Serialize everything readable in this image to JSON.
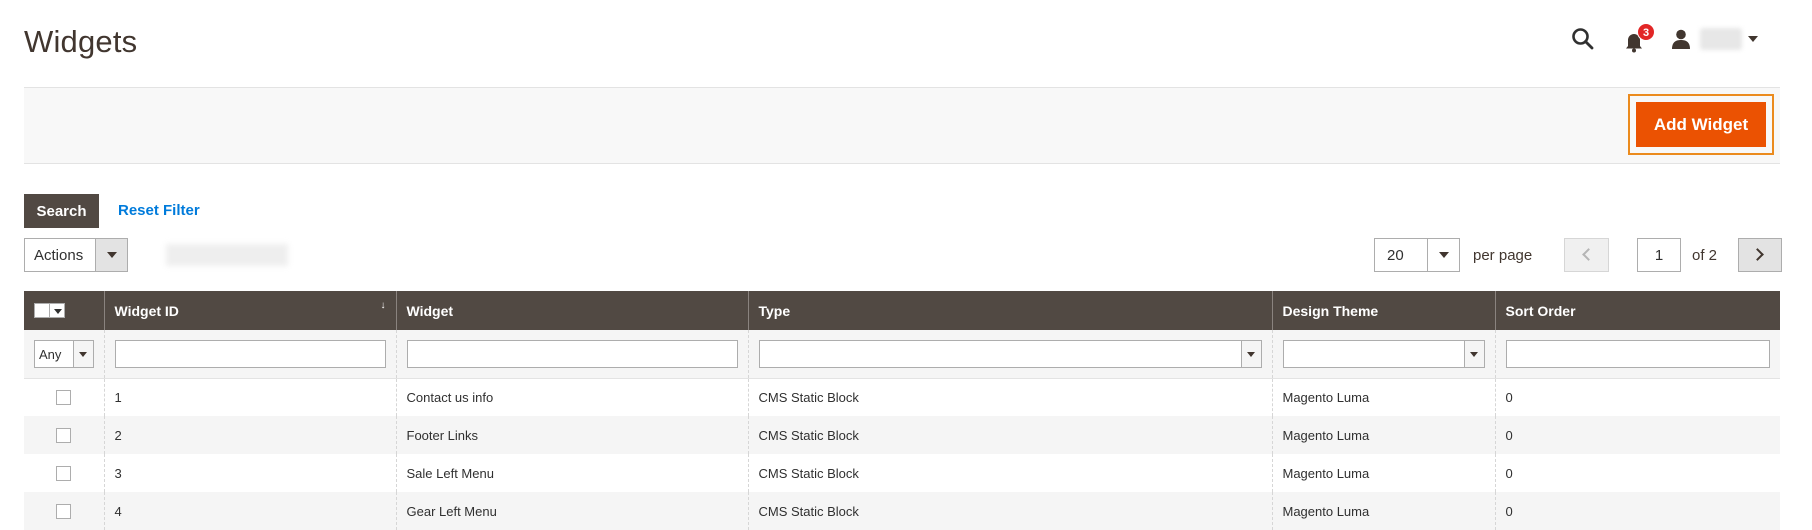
{
  "header": {
    "title": "Widgets",
    "notification_count": "3",
    "icons": {
      "search": "search-icon",
      "notifications": "bell-icon",
      "user": "user-icon"
    }
  },
  "page_actions": {
    "add_widget_label": "Add Widget"
  },
  "toolbar": {
    "search_label": "Search",
    "reset_filter_label": "Reset Filter",
    "actions_label": "Actions",
    "per_page_value": "20",
    "per_page_label": "per page",
    "current_page": "1",
    "total_pages_label": "of 2"
  },
  "grid": {
    "columns": [
      "Widget ID",
      "Widget",
      "Type",
      "Design Theme",
      "Sort Order"
    ],
    "sort_indicator": "↓",
    "filters": {
      "massaction_any": "Any"
    },
    "rows": [
      {
        "id": "1",
        "widget": "Contact us info",
        "type": "CMS Static Block",
        "theme": "Magento Luma",
        "sort": "0"
      },
      {
        "id": "2",
        "widget": "Footer Links",
        "type": "CMS Static Block",
        "theme": "Magento Luma",
        "sort": "0"
      },
      {
        "id": "3",
        "widget": "Sale Left Menu",
        "type": "CMS Static Block",
        "theme": "Magento Luma",
        "sort": "0"
      },
      {
        "id": "4",
        "widget": "Gear Left Menu",
        "type": "CMS Static Block",
        "theme": "Magento Luma",
        "sort": "0"
      }
    ]
  },
  "colors": {
    "accent": "#eb5202",
    "header_bg": "#514943",
    "link": "#007bdb",
    "badge": "#e22626"
  }
}
